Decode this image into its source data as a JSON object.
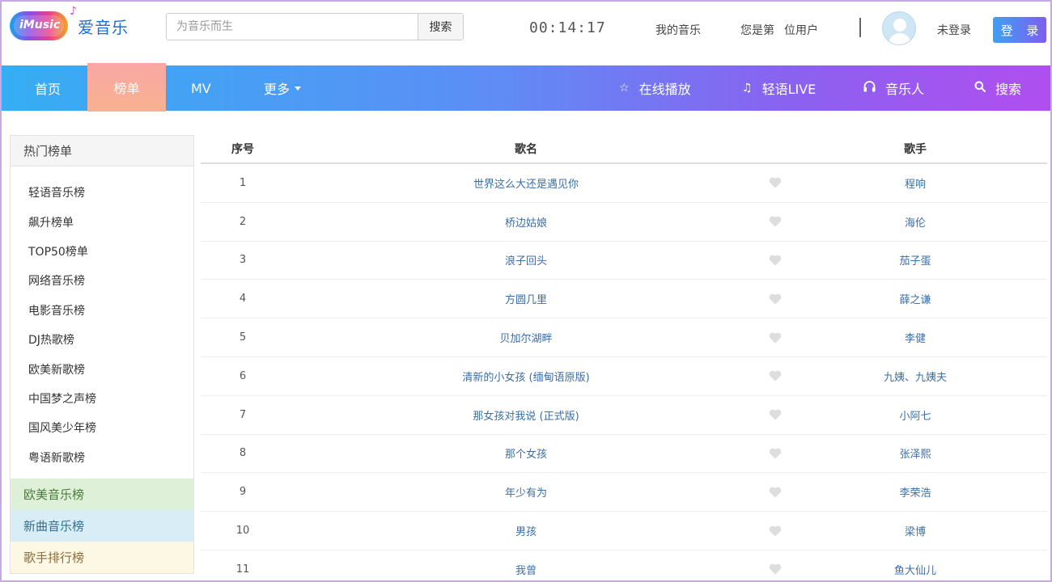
{
  "header": {
    "logo_en": "iMusic",
    "logo_cn": "爱音乐",
    "search_placeholder": "为音乐而生",
    "search_button": "搜索",
    "clock": "00:14:17",
    "my_music": "我的音乐",
    "user_count_prefix": "您是第",
    "user_count_suffix": "位用户",
    "not_logged_in": "未登录",
    "login_button": "登 录"
  },
  "nav": {
    "home": "首页",
    "charts": "榜单",
    "mv": "MV",
    "more": "更多",
    "online_play": "在线播放",
    "live": "轻语LIVE",
    "musicians": "音乐人",
    "search": "搜索"
  },
  "sidebar": {
    "title": "热门榜单",
    "items": [
      "轻语音乐榜",
      "飙升榜单",
      "TOP50榜单",
      "网络音乐榜",
      "电影音乐榜",
      "DJ热歌榜",
      "欧美新歌榜",
      "中国梦之声榜",
      "国风美少年榜",
      "粤语新歌榜"
    ],
    "blocks": [
      {
        "label": "欧美音乐榜",
        "bg": "#dff0d8",
        "color": "#4a7a3a"
      },
      {
        "label": "新曲音乐榜",
        "bg": "#d9edf7",
        "color": "#31708f"
      },
      {
        "label": "歌手排行榜",
        "bg": "#fcf8e3",
        "color": "#8a6d3b"
      }
    ]
  },
  "table": {
    "headers": {
      "index": "序号",
      "song": "歌名",
      "singer": "歌手"
    },
    "rows": [
      {
        "index": "1",
        "song": "世界这么大还是遇见你",
        "singer": "程响"
      },
      {
        "index": "2",
        "song": "桥边姑娘",
        "singer": "海伦"
      },
      {
        "index": "3",
        "song": "浪子回头",
        "singer": "茄子蛋"
      },
      {
        "index": "4",
        "song": "方圆几里",
        "singer": "薛之谦"
      },
      {
        "index": "5",
        "song": "贝加尔湖畔",
        "singer": "李健"
      },
      {
        "index": "6",
        "song": "清新的小女孩 (缅甸语原版)",
        "singer": "九姨、九姨夫"
      },
      {
        "index": "7",
        "song": "那女孩对我说 (正式版)",
        "singer": "小阿七"
      },
      {
        "index": "8",
        "song": "那个女孩",
        "singer": "张泽熙"
      },
      {
        "index": "9",
        "song": "年少有为",
        "singer": "李荣浩"
      },
      {
        "index": "10",
        "song": "男孩",
        "singer": "梁博"
      },
      {
        "index": "11",
        "song": "我曾",
        "singer": "鱼大仙儿"
      }
    ]
  },
  "colors": {
    "accent_blue": "#35aef3",
    "accent_purple": "#b14ef0",
    "active_tab": "#f9a7a4",
    "link": "#3b6ea5",
    "heart": "#dddddd"
  }
}
